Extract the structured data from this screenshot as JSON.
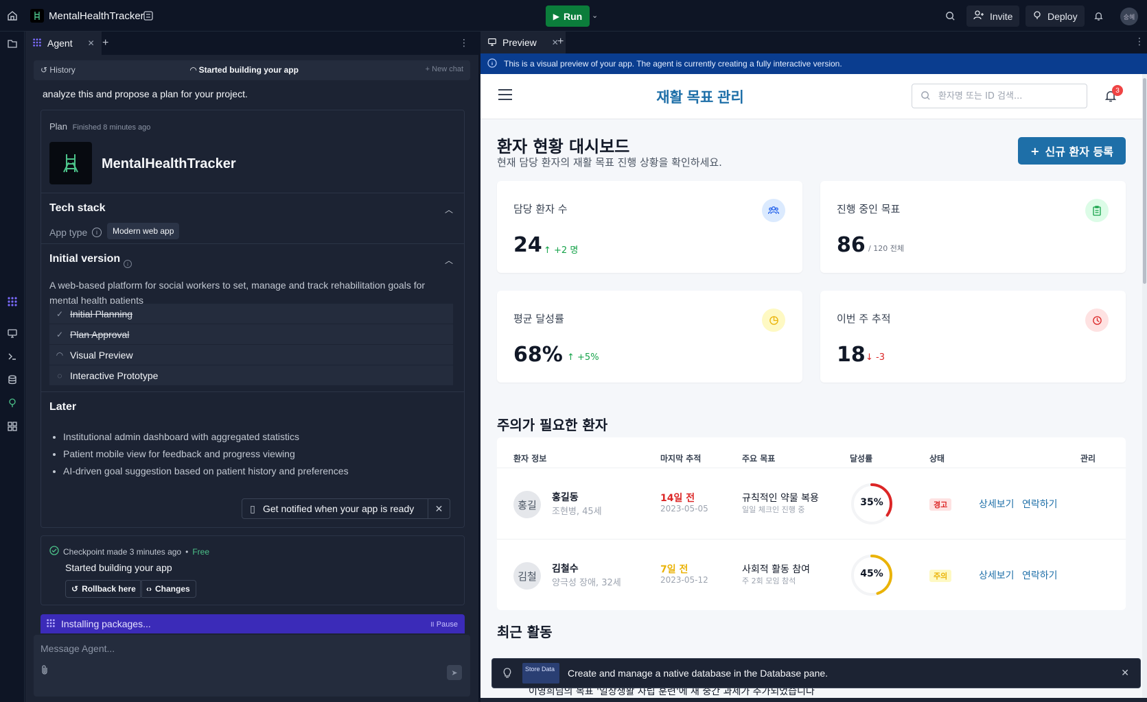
{
  "topbar": {
    "app_name": "MentalHealthTracker",
    "run_label": "Run",
    "invite_label": "Invite",
    "deploy_label": "Deploy",
    "avatar_text": "숭혜",
    "accent_run": "#0b7d3b"
  },
  "agent": {
    "tab_label": "Agent",
    "history_label": "History",
    "status_label": "Started building your app",
    "new_chat_label": "New chat",
    "intro_text": "analyze this and propose a plan for your project.",
    "plan": {
      "label": "Plan",
      "finished": "Finished 8 minutes ago",
      "project_name": "MentalHealthTracker",
      "tech_stack_title": "Tech stack",
      "app_type_label": "App type",
      "app_type_value": "Modern web app",
      "initial_version_title": "Initial version",
      "initial_version_desc": "A web-based platform for social workers to set, manage and track rehabilitation goals for mental health patients",
      "steps": [
        {
          "label": "Initial Planning",
          "state": "done"
        },
        {
          "label": "Plan Approval",
          "state": "done"
        },
        {
          "label": "Visual Preview",
          "state": "in-progress"
        },
        {
          "label": "Interactive Prototype",
          "state": "pending"
        }
      ],
      "later_title": "Later",
      "later_items": [
        "Institutional admin dashboard with aggregated statistics",
        "Patient mobile view for feedback and progress viewing",
        "AI-driven goal suggestion based on patient history and preferences"
      ],
      "notify_label": "Get notified when your app is ready"
    },
    "checkpoint": {
      "made": "Checkpoint made 3 minutes ago",
      "dot": "•",
      "free": "Free",
      "title": "Started building your app",
      "rollback_label": "Rollback here",
      "changes_label": "Changes"
    },
    "installing_label": "Installing packages...",
    "pause_label": "Pause",
    "composer_placeholder": "Message Agent..."
  },
  "preview": {
    "tab_label": "Preview",
    "banner_text": "This is a visual preview of your app. The agent is currently creating a fully interactive version.",
    "app": {
      "title": "재활 목표 관리",
      "search_placeholder": "환자명 또는 ID 검색...",
      "notification_count": "3",
      "dashboard_title": "환자 현황 대시보드",
      "dashboard_sub": "현재 담당 환자의 재활 목표 진행 상황을 확인하세요.",
      "new_patient_label": "신규 환자 등록",
      "stats": [
        {
          "label": "담당 환자 수",
          "value": "24",
          "delta": "+2 명",
          "trend": "up",
          "icon": "users-icon",
          "color": "#2563eb"
        },
        {
          "label": "진행 중인 목표",
          "value": "86",
          "delta": "/ 120 전체",
          "trend": "none",
          "icon": "clipboard-icon",
          "color": "#16a34a"
        },
        {
          "label": "평균 달성률",
          "value": "68%",
          "delta": "+5%",
          "trend": "up",
          "icon": "pie-icon",
          "color": "#eab308"
        },
        {
          "label": "이번 주 추적",
          "value": "18",
          "delta": "-3",
          "trend": "down",
          "icon": "clock-icon",
          "color": "#dc2626"
        }
      ],
      "attention_title": "주의가 필요한 환자",
      "table_headers": [
        "환자 정보",
        "마지막 추적",
        "주요 목표",
        "달성률",
        "상태",
        "관리"
      ],
      "patients": [
        {
          "initials": "홍길",
          "name": "홍길동",
          "info": "조현병, 45세",
          "last": "14일 전",
          "last_date": "2023-05-05",
          "goal": "규칙적인 약물 복용",
          "goal_detail": "일일 체크인 진행 중",
          "progress": 35,
          "progress_label": "35%",
          "status": "경고",
          "status_color": "#dc2626",
          "detail_label": "상세보기",
          "contact_label": "연락하기"
        },
        {
          "initials": "김철",
          "name": "김철수",
          "info": "양극성 장애, 32세",
          "last": "7일 전",
          "last_date": "2023-05-12",
          "goal": "사회적 활동 참여",
          "goal_detail": "주 2회 모임 참석",
          "progress": 45,
          "progress_label": "45%",
          "status": "주의",
          "status_color": "#eab308",
          "detail_label": "상세보기",
          "contact_label": "연락하기"
        }
      ],
      "recent_title": "최근 활동",
      "recent_item": "이영희님의 목표 '일상생활 자립 훈련'에 새 중간 과제가 추가되었습니다"
    }
  },
  "toast": {
    "thumb_text": "Store Data",
    "message": "Create and manage a native database in the Database pane."
  }
}
